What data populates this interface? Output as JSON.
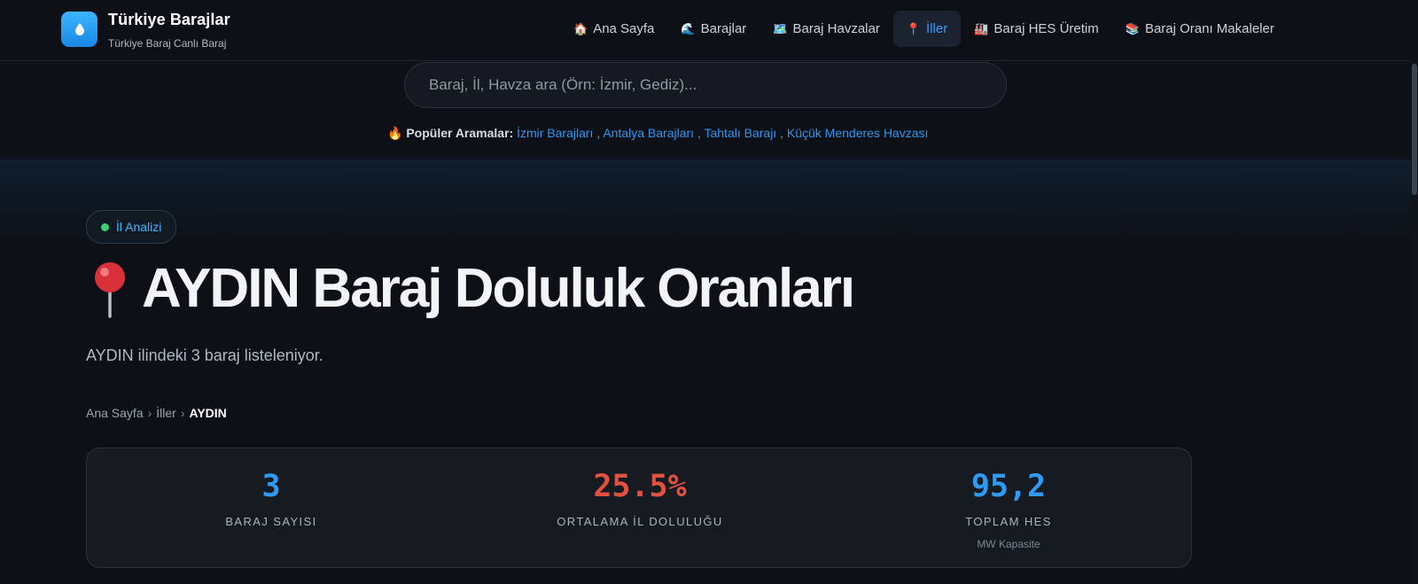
{
  "header": {
    "title": "Türkiye Barajlar",
    "subtitle": "Türkiye Baraj Canlı Baraj",
    "logo_icon": "water-drop-icon"
  },
  "nav": [
    {
      "label": "Ana Sayfa",
      "icon": "🏠",
      "active": false
    },
    {
      "label": "Barajlar",
      "icon": "🌊",
      "active": false
    },
    {
      "label": "Baraj Havzalar",
      "icon": "🗺️",
      "active": false
    },
    {
      "label": "İller",
      "icon": "📍",
      "active": true
    },
    {
      "label": "Baraj HES Üretim",
      "icon": "🏭",
      "active": false
    },
    {
      "label": "Baraj Oranı Makaleler",
      "icon": "📚",
      "active": false
    }
  ],
  "search": {
    "placeholder": "Baraj, İl, Havza ara (Örn: İzmir, Gediz)...",
    "value": ""
  },
  "popular": {
    "icon": "🔥",
    "label": "Popüler Aramalar:",
    "links": [
      "İzmir Barajları",
      "Antalya Barajları",
      "Tahtalı Barajı",
      "Küçük Menderes Havzası"
    ]
  },
  "hero": {
    "badge": "İl Analizi",
    "title": "AYDIN Baraj Doluluk Oranları",
    "description": "AYDIN ilindeki 3 baraj listeleniyor."
  },
  "breadcrumb": {
    "items": [
      "Ana Sayfa",
      "İller"
    ],
    "current": "AYDIN"
  },
  "stats": [
    {
      "value": "3",
      "label": "BARAJ SAYISI",
      "note": "",
      "color": "#2f9bf5"
    },
    {
      "value": "25.5%",
      "label": "ORTALAMA İL DOLULUĞU",
      "note": "",
      "color": "#e0523f"
    },
    {
      "value": "95,2",
      "label": "TOPLAM HES",
      "note": "MW Kapasite",
      "color": "#2f9bf5"
    }
  ],
  "colors": {
    "background": "#0d1117",
    "accent": "#2f9bff",
    "badge_dot": "#3ccf73"
  }
}
